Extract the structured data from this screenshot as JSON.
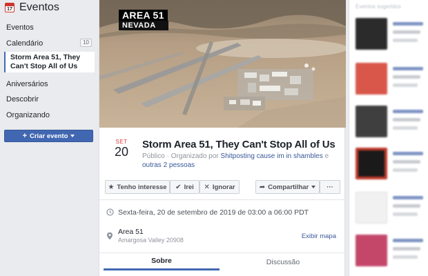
{
  "sidebar": {
    "title": "Eventos",
    "calendar_icon_day": "17",
    "items": [
      {
        "label": "Eventos"
      },
      {
        "label": "Calendário",
        "badge": "10"
      }
    ],
    "active_item": "Storm Area 51, They Can't Stop All of Us",
    "items_after": [
      {
        "label": "Aniversários"
      },
      {
        "label": "Descobrir"
      },
      {
        "label": "Organizando"
      }
    ],
    "create_button": "Criar evento"
  },
  "event": {
    "cover_text": {
      "line1": "AREA 51",
      "line2": "NEVADA"
    },
    "month": "SET",
    "day": "20",
    "title": "Storm Area 51, They Can't Stop All of Us",
    "meta": {
      "prefix": "Público · Organizado por ",
      "organizer": "Shitposting cause im in shambles",
      "middle": " e ",
      "others": "outras 2 pessoas"
    },
    "buttons": {
      "interested": "Tenho interesse",
      "going": "Irei",
      "ignore": "Ignorar",
      "share": "Compartilhar",
      "more": "···"
    },
    "datetime": "Sexta-feira, 20 de setembro de 2019 de 03:00 a 06:00 PDT",
    "location": {
      "name": "Area 51",
      "address": "Amargosa Valley 20908",
      "map_link": "Exibir mapa"
    },
    "tabs": {
      "about": "Sobre",
      "discussion": "Discussão"
    }
  },
  "right_column": {
    "header": "Eventos sugeridos"
  },
  "colors": {
    "accent": "#4267b2",
    "date_red": "#e0393e",
    "link": "#385898",
    "page_bg": "#e9ebee"
  },
  "icons": {
    "calendar": "calendar-icon",
    "star": "star-icon",
    "check": "check-icon",
    "x": "x-icon",
    "share": "share-icon",
    "clock": "clock-icon",
    "pin": "location-pin-icon"
  }
}
